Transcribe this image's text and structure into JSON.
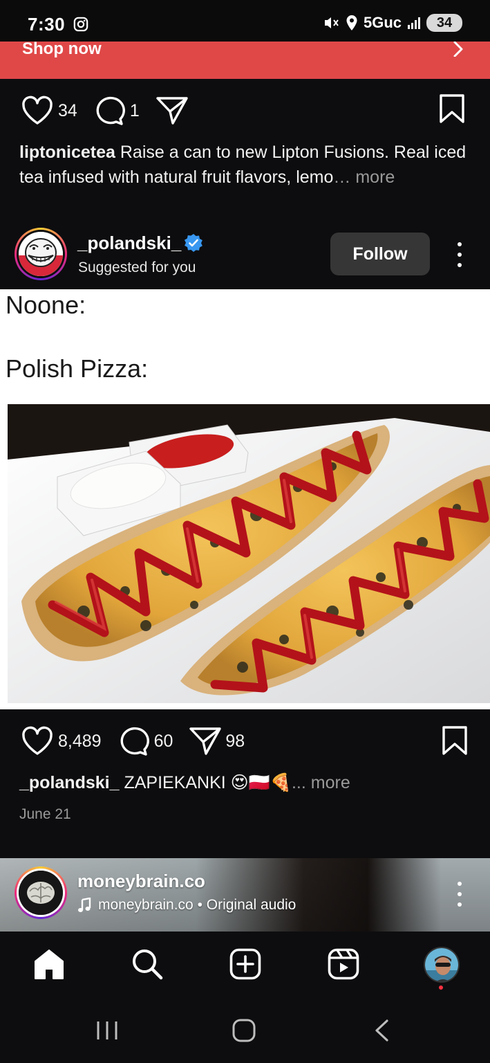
{
  "status_bar": {
    "time": "7:30",
    "network": "5Guc",
    "battery": "34",
    "icons": [
      "instagram-icon",
      "mute-icon",
      "location-icon",
      "signal-icon",
      "battery-icon"
    ]
  },
  "ad_banner": {
    "cta_label": "Shop now",
    "color": "#e04848"
  },
  "post_previous": {
    "likes": "34",
    "comments": "1",
    "caption_user": "liptonicetea",
    "caption_text": "Raise a can to new Lipton Fusions. Real iced tea infused with natural fruit flavors, lemo",
    "caption_more": "… more"
  },
  "post_main": {
    "username": "_polandski_",
    "verified": true,
    "subtitle": "Suggested for you",
    "follow_label": "Follow",
    "meme_line1": "Noone:",
    "meme_line2": "Polish Pizza:",
    "likes": "8,489",
    "comments": "60",
    "shares": "98",
    "caption_user": "_polandski_",
    "caption_text": "ZAPIEKANKI 😍🇵🇱🍕",
    "caption_more": "... more",
    "date": "June 21"
  },
  "reel_next": {
    "username": "moneybrain.co",
    "audio": "moneybrain.co • Original audio"
  },
  "tab_bar": {
    "items": [
      "home-icon",
      "search-icon",
      "create-icon",
      "reels-icon",
      "profile-avatar"
    ]
  },
  "colors": {
    "background": "#0d0d0f",
    "follow_button": "#363636",
    "verified": "#3897f0",
    "muted_text": "#9a9a9a"
  }
}
